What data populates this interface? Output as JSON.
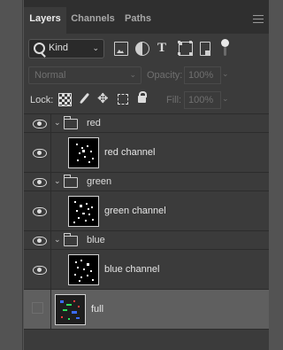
{
  "tabs": [
    "Layers",
    "Channels",
    "Paths"
  ],
  "filter": {
    "kind_label": "Kind"
  },
  "blend": {
    "mode": "Normal",
    "opacity_label": "Opacity:",
    "opacity_value": "100%"
  },
  "lock": {
    "label": "Lock:",
    "fill_label": "Fill:",
    "fill_value": "100%"
  },
  "layers": [
    {
      "type": "group",
      "name": "red"
    },
    {
      "type": "layer",
      "name": "red channel"
    },
    {
      "type": "group",
      "name": "green"
    },
    {
      "type": "layer",
      "name": "green channel"
    },
    {
      "type": "group",
      "name": "blue"
    },
    {
      "type": "layer",
      "name": "blue channel"
    },
    {
      "type": "layer",
      "name": "full"
    }
  ]
}
